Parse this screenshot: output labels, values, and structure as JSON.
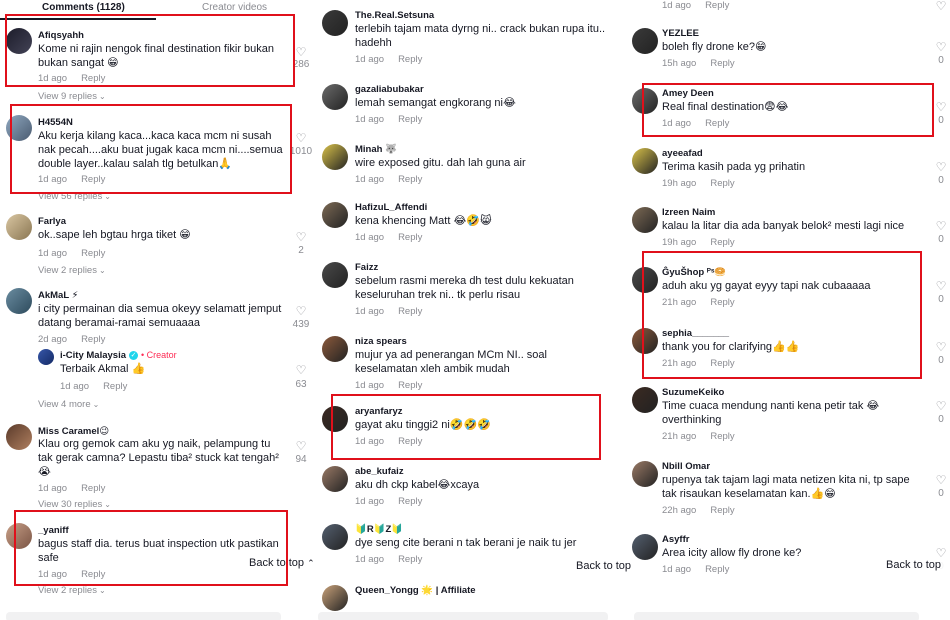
{
  "tabs": {
    "comments": "Comments (1128)",
    "creator_videos": "Creator videos"
  },
  "back_to_top": "Back to top",
  "panel1": {
    "comments": [
      {
        "username": "Afiqsyahh",
        "text": "Kome ni rajin nengok final destination fikir bukan bukan sangat 😁",
        "time": "1d ago",
        "reply": "Reply",
        "likes": "286",
        "view_replies": "View 9 replies"
      },
      {
        "username": "H4554N",
        "text": "Aku kerja kilang kaca...kaca kaca mcm ni susah nak pecah....aku buat jugak kaca mcm ni....semua double layer..kalau salah tlg betulkan🙏",
        "time": "1d ago",
        "reply": "Reply",
        "likes": "1010",
        "view_replies": "View 56 replies"
      },
      {
        "username": "Farlya",
        "text": "ok..sape leh bgtau hrga tiket 😁",
        "time": "1d ago",
        "reply": "Reply",
        "likes": "2",
        "view_replies": "View 2 replies"
      },
      {
        "username": "AkMaL ⚡",
        "text": "i city permainan dia semua okeyy selamatt jemput datang beramai-ramai semuaaaa",
        "time": "2d ago",
        "reply": "Reply",
        "likes": "439",
        "view_replies": "View 4 more"
      },
      {
        "username": "Miss Caramel😉",
        "text": "Klau org gemok cam aku yg naik, pelampung tu tak gerak camna? Lepastu tiba² stuck kat tengah²😭",
        "time": "1d ago",
        "reply": "Reply",
        "likes": "94",
        "view_replies": "View 30 replies"
      },
      {
        "username": "_yaniff",
        "text": "bagus staff dia. terus buat inspection utk pastikan safe",
        "time": "1d ago",
        "reply": "Reply",
        "likes": "",
        "view_replies": "View 2 replies"
      }
    ],
    "creator_reply": {
      "username": "i-City Malaysia",
      "creator_label": "Creator",
      "text": "Terbaik Akmal 👍",
      "time": "1d ago",
      "reply": "Reply",
      "likes": "63"
    }
  },
  "panel2": {
    "comments": [
      {
        "username": "The.Real.Setsuna",
        "text": "terlebih tajam mata dyrng ni.. crack bukan rupa itu.. hadehh",
        "time": "1d ago",
        "reply": "Reply"
      },
      {
        "username": "gazaliabubakar",
        "text": "lemah semangat engkorang ni😂",
        "time": "1d ago",
        "reply": "Reply"
      },
      {
        "username": "Minah 🐺",
        "text": "wire exposed gitu. dah lah guna air",
        "time": "1d ago",
        "reply": "Reply"
      },
      {
        "username": "HafizuL_Affendi",
        "text": "kena khencing Matt 😂🤣😸",
        "time": "1d ago",
        "reply": "Reply"
      },
      {
        "username": "Faizz",
        "text": "sebelum rasmi mereka dh test dulu kekuatan keseluruhan trek ni.. tk perlu risau",
        "time": "1d ago",
        "reply": "Reply"
      },
      {
        "username": "niza spears",
        "text": "mujur ya ad penerangan MCm NI.. soal keselamatan xleh ambik mudah",
        "time": "1d ago",
        "reply": "Reply"
      },
      {
        "username": "aryanfaryz",
        "text": "gayat aku tinggi2 ni🤣🤣🤣",
        "time": "1d ago",
        "reply": "Reply"
      },
      {
        "username": "abe_kufaiz",
        "text": "aku dh ckp kabel😂xcaya",
        "time": "1d ago",
        "reply": "Reply"
      },
      {
        "username": "🔰R🔰Z🔰",
        "text": "dye seng cite berani n tak berani je naik tu jer",
        "time": "1d ago",
        "reply": "Reply"
      },
      {
        "username": "Queen_Yongg 🌟 | Affiliate",
        "text": "",
        "time": "",
        "reply": ""
      }
    ]
  },
  "panel3": {
    "top_meta": {
      "time": "1d ago",
      "reply": "Reply"
    },
    "comments": [
      {
        "username": "YEZLEE",
        "text": "boleh fly drone ke?😁",
        "time": "15h ago",
        "reply": "Reply",
        "likes": "0"
      },
      {
        "username": "Amey Deen",
        "text": "Real final destination😨😂",
        "time": "1d ago",
        "reply": "Reply",
        "likes": "0"
      },
      {
        "username": "ayeeafad",
        "text": "Terima kasih pada yg prihatin",
        "time": "19h ago",
        "reply": "Reply",
        "likes": "0"
      },
      {
        "username": "Izreen Naim",
        "text": "kalau la litar dia ada banyak belok² mesti lagi nice",
        "time": "19h ago",
        "reply": "Reply",
        "likes": "0"
      },
      {
        "username": "ĜyuŠhop ᴾˢ🥯",
        "text": "aduh aku yg gayat eyyy tapi nak cubaaaaa",
        "time": "21h ago",
        "reply": "Reply",
        "likes": "0"
      },
      {
        "username": "sephia_______",
        "text": "thank you for clarifying👍👍",
        "time": "21h ago",
        "reply": "Reply",
        "likes": "0"
      },
      {
        "username": "SuzumeKeiko",
        "text": "Time cuaca mendung nanti kena petir tak 😂 overthinking",
        "time": "21h ago",
        "reply": "Reply",
        "likes": "0"
      },
      {
        "username": "Nbill Omar",
        "text": "rupenya tak tajam lagi mata netizen kita ni, tp sape tak risaukan keselamatan kan.👍😁",
        "time": "22h ago",
        "reply": "Reply",
        "likes": "0"
      },
      {
        "username": "Asyffr",
        "text": "Area icity allow fly drone ke?",
        "time": "1d ago",
        "reply": "Reply",
        "likes": "0"
      }
    ]
  },
  "colors": {
    "highlight": "#e0101b",
    "creator": "#fe2c55",
    "muted": "#8a8b91",
    "text": "#161823"
  },
  "icons": {
    "like": "heart-icon",
    "chevron": "chevron-down-icon",
    "back_to_top": "arrow-up-icon"
  }
}
